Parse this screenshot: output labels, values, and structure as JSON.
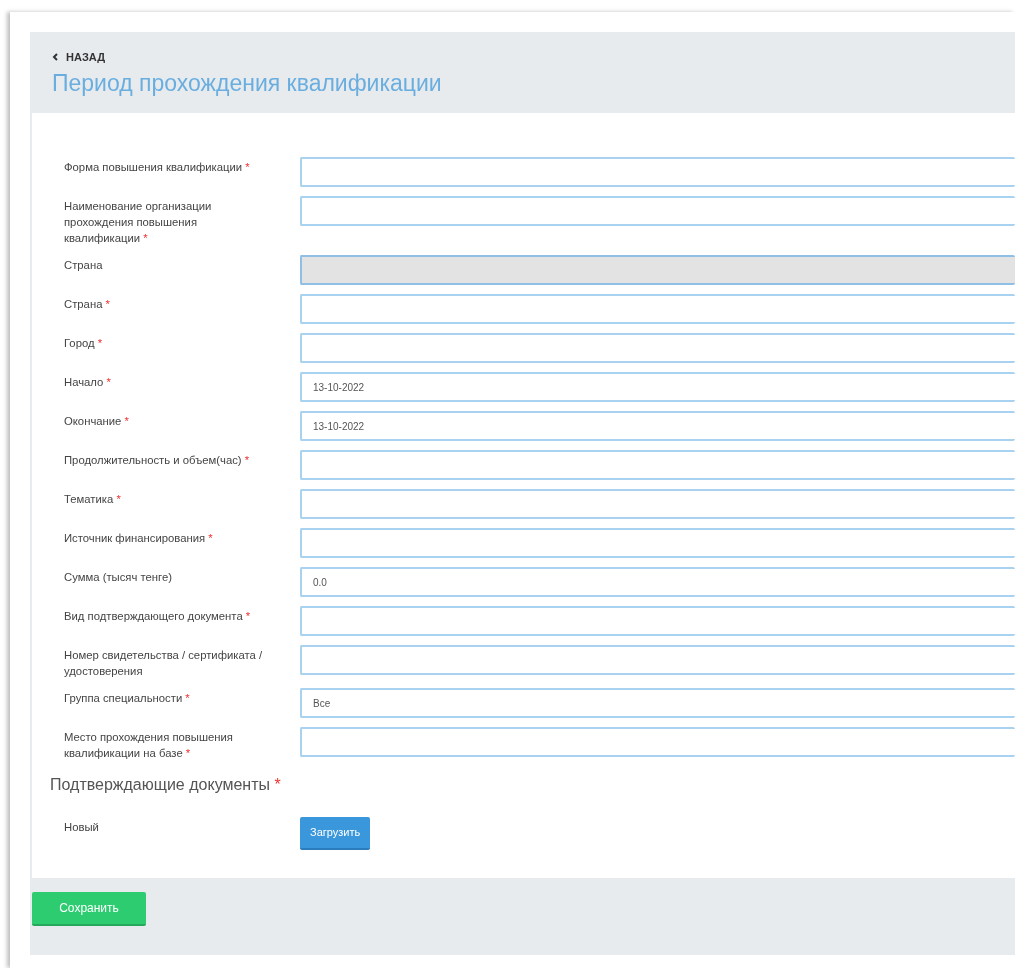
{
  "back_link": {
    "label": "НАЗАД"
  },
  "title": "Период прохождения квалификации",
  "fields": [
    {
      "label": "Форма повышения квалификации",
      "required": true,
      "disabled": false
    },
    {
      "label": "Наименование организации прохождения повышения квалификации",
      "required": true,
      "disabled": false
    },
    {
      "label": "Страна",
      "required": false,
      "disabled": true
    },
    {
      "label": "Страна",
      "required": true,
      "disabled": false
    },
    {
      "label": "Город",
      "required": true,
      "disabled": false
    },
    {
      "label": "Начало",
      "required": true,
      "disabled": false,
      "value": "13-10-2022"
    },
    {
      "label": "Окончание",
      "required": true,
      "disabled": false,
      "value": "13-10-2022"
    },
    {
      "label": "Продолжительность и объем(час)",
      "required": true,
      "disabled": false
    },
    {
      "label": "Тематика",
      "required": true,
      "disabled": false
    },
    {
      "label": "Источник финансирования",
      "required": true,
      "disabled": false
    },
    {
      "label": "Сумма (тысяч тенге)",
      "required": false,
      "disabled": false,
      "value": "0.0"
    },
    {
      "label": "Вид подтверждающего документа",
      "required": true,
      "disabled": false
    },
    {
      "label": "Номер свидетельства / сертификата / удостоверения",
      "required": false,
      "disabled": false
    },
    {
      "label": "Группа специальности",
      "required": true,
      "disabled": false,
      "value": "Все"
    },
    {
      "label": "Место прохождения повышения квалификации на базе",
      "required": true,
      "disabled": false
    }
  ],
  "documents": {
    "heading": "Подтверждающие документы",
    "required": true,
    "row_label": "Новый",
    "upload_button": "Загрузить"
  },
  "save_button": "Сохранить",
  "required_mark": "*"
}
